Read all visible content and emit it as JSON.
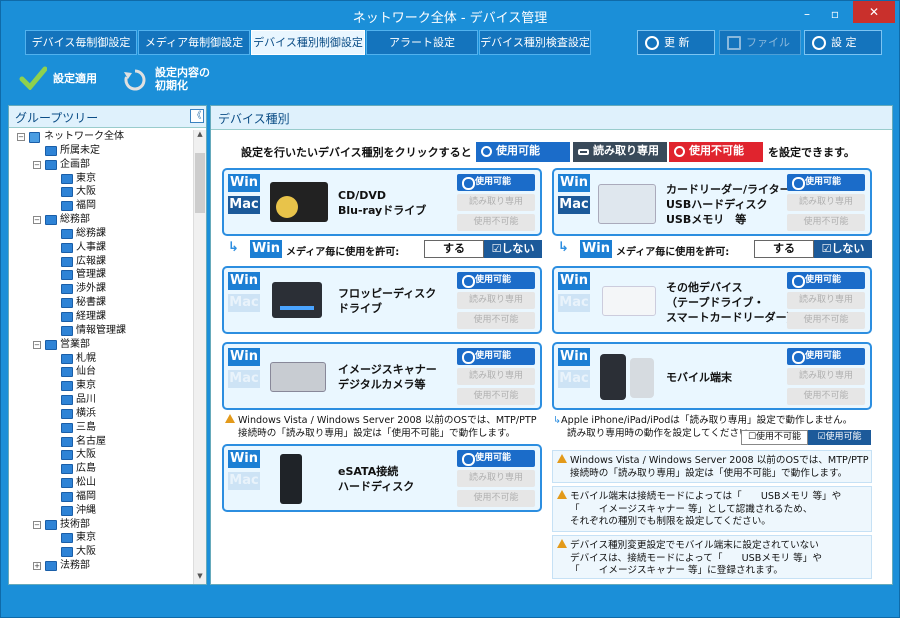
{
  "window": {
    "title": "ネットワーク全体 - デバイス管理",
    "minimize": "–",
    "restore": "▫",
    "close": "✕"
  },
  "tabs": [
    {
      "label": "デバイス毎制御設定"
    },
    {
      "label": "メディア毎制御設定"
    },
    {
      "label": "デバイス種別制御設定"
    },
    {
      "label": "アラート設定"
    },
    {
      "label": "デバイス種別検査設定"
    }
  ],
  "top_buttons": {
    "refresh": "更 新",
    "file": "ファイル",
    "settings": "設 定"
  },
  "toolbar": {
    "apply": "設定適用",
    "reset_line1": "設定内容の",
    "reset_line2": "初期化"
  },
  "left": {
    "title": "グループツリー",
    "collapse": "《"
  },
  "tree": [
    {
      "t": "ネットワーク全体",
      "d": 0,
      "g": "−",
      "root": true
    },
    {
      "t": "所属未定",
      "d": 1
    },
    {
      "t": "企画部",
      "d": 1,
      "g": "−"
    },
    {
      "t": "東京",
      "d": 2
    },
    {
      "t": "大阪",
      "d": 2
    },
    {
      "t": "福岡",
      "d": 2
    },
    {
      "t": "総務部",
      "d": 1,
      "g": "−"
    },
    {
      "t": "総務課",
      "d": 2
    },
    {
      "t": "人事課",
      "d": 2
    },
    {
      "t": "広報課",
      "d": 2
    },
    {
      "t": "管理課",
      "d": 2
    },
    {
      "t": "渉外課",
      "d": 2
    },
    {
      "t": "秘書課",
      "d": 2
    },
    {
      "t": "経理課",
      "d": 2
    },
    {
      "t": "情報管理課",
      "d": 2
    },
    {
      "t": "営業部",
      "d": 1,
      "g": "−"
    },
    {
      "t": "札幌",
      "d": 2
    },
    {
      "t": "仙台",
      "d": 2
    },
    {
      "t": "東京",
      "d": 2
    },
    {
      "t": "品川",
      "d": 2
    },
    {
      "t": "横浜",
      "d": 2
    },
    {
      "t": "三島",
      "d": 2
    },
    {
      "t": "名古屋",
      "d": 2
    },
    {
      "t": "大阪",
      "d": 2
    },
    {
      "t": "広島",
      "d": 2
    },
    {
      "t": "松山",
      "d": 2
    },
    {
      "t": "福岡",
      "d": 2
    },
    {
      "t": "沖縄",
      "d": 2
    },
    {
      "t": "技術部",
      "d": 1,
      "g": "−"
    },
    {
      "t": "東京",
      "d": 2
    },
    {
      "t": "大阪",
      "d": 2
    },
    {
      "t": "法務部",
      "d": 1,
      "g": "+"
    }
  ],
  "main": {
    "title": "デバイス種別",
    "intro": "設定を行いたいデバイス種別をクリックすると",
    "chip_usable": "使用可能",
    "chip_readonly": "読み取り専用",
    "chip_unusable": "使用不可能",
    "intro2": "を設定できます。",
    "win": "Win",
    "mac": "Mac",
    "opt_usable": "使用可能",
    "opt_readonly": "読み取り専用",
    "opt_unusable": "使用不可能",
    "cards": {
      "cd": {
        "l1": "CD/DVD",
        "l2": "Blu-rayドライブ"
      },
      "card": {
        "l1": "カードリーダー/ライター",
        "l2": "USBハードディスク",
        "l3": "USBメモリ　等"
      },
      "fd": {
        "l1": "フロッピーディスク",
        "l2": "ドライブ"
      },
      "other": {
        "l1": "その他デバイス",
        "l2": "（テープドライブ・",
        "l3": "スマートカードリーダー）"
      },
      "scan": {
        "l1": "イメージスキャナー",
        "l2": "デジタルカメラ等"
      },
      "mobile": {
        "l1": "モバイル端末"
      },
      "esata": {
        "l1": "eSATA接続",
        "l2": "ハードディスク"
      }
    },
    "media_allow": "メディア毎に使用を許可:",
    "media_yes": "する",
    "media_no": "しない",
    "note_left_1": "Windows Vista / Windows Server 2008 以前のOSでは、MTP/PTP",
    "note_left_2": "接続時の「読み取り専用」設定は「使用不可能」で動作します。",
    "note_apple_1": "Apple iPhone/iPad/iPodは「読み取り専用」設定で動作しません。",
    "note_apple_2": "読み取り専用時の動作を設定してください。",
    "apple_opt_unusable": "使用不可能",
    "apple_opt_usable": "使用可能",
    "box1_1": "Windows Vista / Windows Server 2008 以前のOSでは、MTP/PTP",
    "box1_2": "接続時の「読み取り専用」設定は「使用不可能」で動作します。",
    "box2_1": "モバイル端末は接続モードによっては「　　USBメモリ 等」や",
    "box2_2": "「　　イメージスキャナー 等」として認識されるため、",
    "box2_3": "それぞれの種別でも制限を設定してください。",
    "box3_1": "デバイス種別変更設定でモバイル端末に設定されていない",
    "box3_2": "デバイスは、接続モードによって「　　USBメモリ 等」や",
    "box3_3": "「　　イメージスキャナー 等」に登録されます。"
  }
}
